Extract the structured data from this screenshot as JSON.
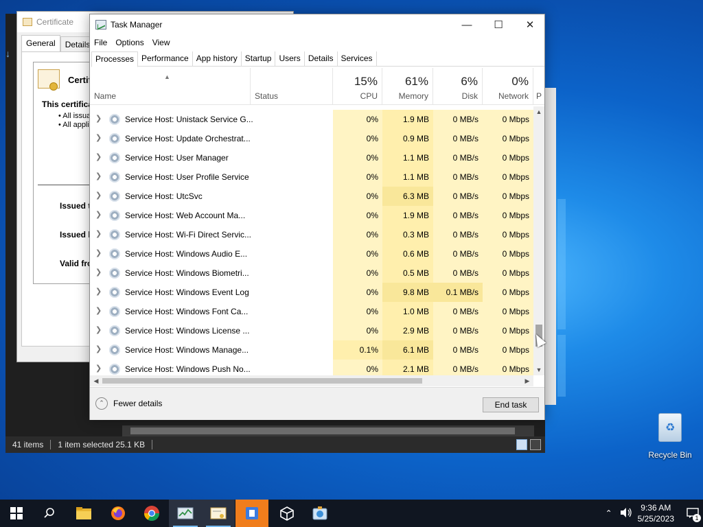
{
  "explorer": {
    "status_items": "41 items",
    "status_selected": "1 item selected  25.1 KB"
  },
  "certificate": {
    "title": "Certificate",
    "tabs": [
      "General",
      "Details"
    ],
    "heading": "Certifi",
    "info_line": "This certifica",
    "bullets": [
      "• All issua",
      "• All appli"
    ],
    "issued_to": "Issued t",
    "issued_by": "Issued b",
    "valid_from": "Valid fro"
  },
  "taskmanager": {
    "title": "Task Manager",
    "menu": [
      "File",
      "Options",
      "View"
    ],
    "tabs": [
      "Processes",
      "Performance",
      "App history",
      "Startup",
      "Users",
      "Details",
      "Services"
    ],
    "columns": {
      "name": "Name",
      "status": "Status",
      "cpu_pct": "15%",
      "cpu": "CPU",
      "mem_pct": "61%",
      "mem": "Memory",
      "disk_pct": "6%",
      "disk": "Disk",
      "net_pct": "0%",
      "net": "Network",
      "power_trunc": "P"
    },
    "rows": [
      {
        "name": "Service Host: Unistack Service G...",
        "cpu": "0%",
        "mem": "1.9 MB",
        "disk": "0 MB/s",
        "net": "0 Mbps"
      },
      {
        "name": "Service Host: Update Orchestrat...",
        "cpu": "0%",
        "mem": "0.9 MB",
        "disk": "0 MB/s",
        "net": "0 Mbps"
      },
      {
        "name": "Service Host: User Manager",
        "cpu": "0%",
        "mem": "1.1 MB",
        "disk": "0 MB/s",
        "net": "0 Mbps"
      },
      {
        "name": "Service Host: User Profile Service",
        "cpu": "0%",
        "mem": "1.1 MB",
        "disk": "0 MB/s",
        "net": "0 Mbps"
      },
      {
        "name": "Service Host: UtcSvc",
        "cpu": "0%",
        "mem": "6.3 MB",
        "disk": "0 MB/s",
        "net": "0 Mbps"
      },
      {
        "name": "Service Host: Web Account Ma...",
        "cpu": "0%",
        "mem": "1.9 MB",
        "disk": "0 MB/s",
        "net": "0 Mbps"
      },
      {
        "name": "Service Host: Wi-Fi Direct Servic...",
        "cpu": "0%",
        "mem": "0.3 MB",
        "disk": "0 MB/s",
        "net": "0 Mbps"
      },
      {
        "name": "Service Host: Windows Audio E...",
        "cpu": "0%",
        "mem": "0.6 MB",
        "disk": "0 MB/s",
        "net": "0 Mbps"
      },
      {
        "name": "Service Host: Windows Biometri...",
        "cpu": "0%",
        "mem": "0.5 MB",
        "disk": "0 MB/s",
        "net": "0 Mbps"
      },
      {
        "name": "Service Host: Windows Event Log",
        "cpu": "0%",
        "mem": "9.8 MB",
        "disk": "0.1 MB/s",
        "net": "0 Mbps"
      },
      {
        "name": "Service Host: Windows Font Ca...",
        "cpu": "0%",
        "mem": "1.0 MB",
        "disk": "0 MB/s",
        "net": "0 Mbps"
      },
      {
        "name": "Service Host: Windows License ...",
        "cpu": "0%",
        "mem": "2.9 MB",
        "disk": "0 MB/s",
        "net": "0 Mbps"
      },
      {
        "name": "Service Host: Windows Manage...",
        "cpu": "0.1%",
        "mem": "6.1 MB",
        "disk": "0 MB/s",
        "net": "0 Mbps"
      },
      {
        "name": "Service Host: Windows Push No...",
        "cpu": "0%",
        "mem": "2.1 MB",
        "disk": "0 MB/s",
        "net": "0 Mbps"
      }
    ],
    "fewer_details": "Fewer details",
    "end_task": "End task"
  },
  "desktop": {
    "recycle_bin": "Recycle Bin"
  },
  "taskbar": {
    "time": "9:36 AM",
    "date": "5/25/2023",
    "notification_count": "1"
  },
  "icons": {
    "start": "windows-logo-icon",
    "search": "search-icon",
    "explorer": "folder-icon",
    "firefox": "firefox-icon",
    "chrome": "chrome-icon",
    "taskmgr": "task-manager-icon",
    "cert": "certificate-icon",
    "app": "app-icon",
    "unity": "unity-icon",
    "tool": "tool-icon"
  },
  "colors": {
    "heat_light": "#fff4c4",
    "heat_mid": "#ffefad",
    "heat_strong": "#f9e79a",
    "taskbar": "#101621",
    "accent": "#76b9ed"
  }
}
